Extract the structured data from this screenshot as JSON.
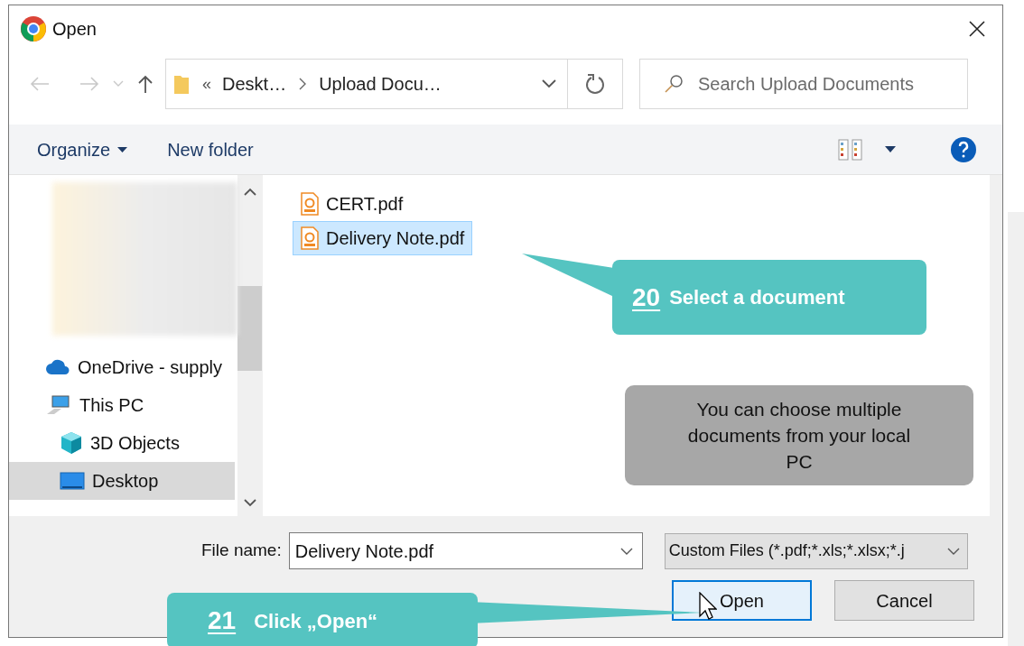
{
  "window": {
    "title": "Open"
  },
  "address_bar": {
    "overflow": "«",
    "crumbs": [
      "Deskt…",
      "Upload Docu…"
    ]
  },
  "search": {
    "placeholder": "Search Upload Documents"
  },
  "toolbar": {
    "organize": "Organize",
    "new_folder": "New folder"
  },
  "nav_pane": [
    {
      "kind": "cloud",
      "label": "OneDrive - supply",
      "selected": false
    },
    {
      "kind": "pc",
      "label": "This PC",
      "selected": false,
      "children": [
        {
          "kind": "cube",
          "label": "3D Objects",
          "selected": false
        },
        {
          "kind": "desktop",
          "label": "Desktop",
          "selected": true
        }
      ]
    }
  ],
  "files": [
    {
      "name": "CERT.pdf",
      "selected": false
    },
    {
      "name": "Delivery Note.pdf",
      "selected": true
    }
  ],
  "footer": {
    "file_name_label": "File name:",
    "file_name": "Delivery Note.pdf",
    "filter": "Custom Files (*.pdf;*.xls;*.xlsx;*.j",
    "buttons": [
      {
        "label": "Open",
        "default": true
      },
      {
        "label": "Cancel",
        "default": false
      }
    ]
  },
  "callouts": [
    {
      "number": "20",
      "text": "Select a document"
    },
    {
      "number": "21",
      "text": "Click „Open“"
    }
  ],
  "note": "You can choose multiple documents from your local PC"
}
